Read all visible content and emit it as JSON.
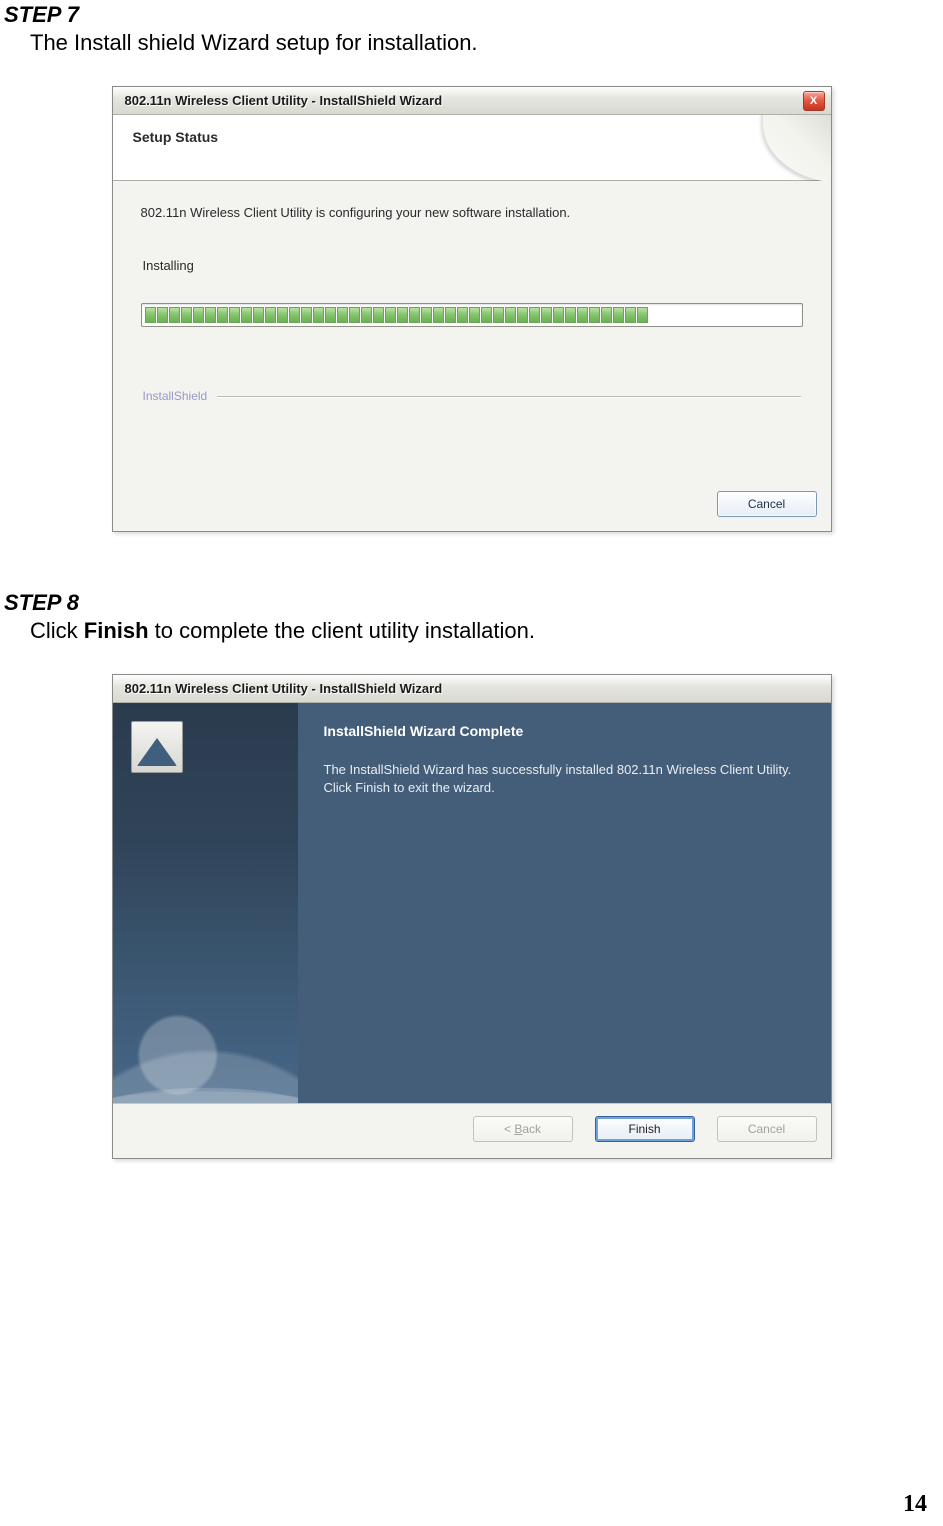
{
  "step7": {
    "heading": "STEP 7",
    "text": "The Install shield Wizard setup for installation.",
    "dialog": {
      "title": "802.11n Wireless Client Utility - InstallShield Wizard",
      "close_glyph": "X",
      "header": "Setup Status",
      "message": "802.11n Wireless Client Utility is configuring your new software installation.",
      "installing_label": "Installing",
      "install_shield_label": "InstallShield",
      "progress_segments": 47,
      "progress_filled": 42,
      "cancel_label": "Cancel"
    }
  },
  "step8": {
    "heading": "STEP 8",
    "text_prefix": "Click ",
    "text_bold": "Finish",
    "text_suffix": " to complete the client utility installation.",
    "dialog": {
      "title": "802.11n Wireless Client Utility - InstallShield Wizard",
      "heading": "InstallShield Wizard Complete",
      "body": "The InstallShield Wizard has successfully installed 802.11n Wireless Client Utility.  Click Finish to exit the wizard.",
      "back_label": "< Back",
      "finish_label": "Finish",
      "cancel_label": "Cancel"
    }
  },
  "page_number": "14"
}
